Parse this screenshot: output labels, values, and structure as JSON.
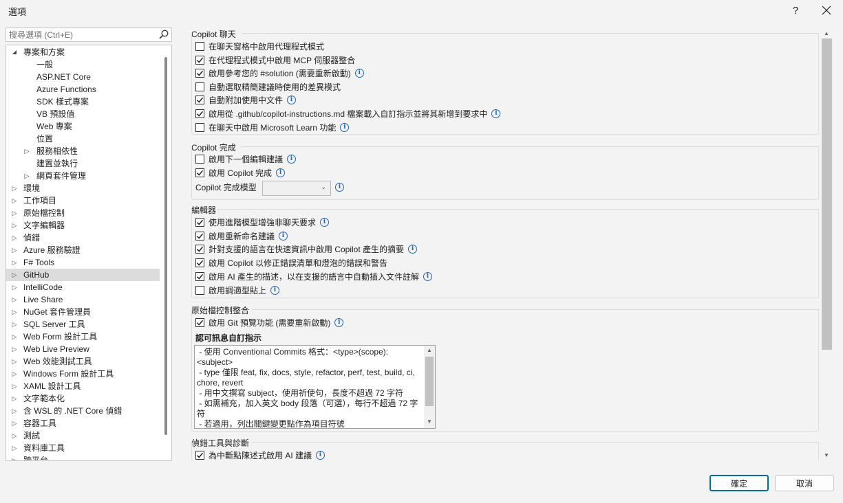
{
  "window": {
    "title": "選項",
    "help_label": "?",
    "close_label": "✕"
  },
  "search": {
    "placeholder": "搜尋選項 (Ctrl+E)"
  },
  "tree": {
    "items": [
      {
        "label": "專案和方案",
        "arrow": "◢",
        "expanded": true
      },
      {
        "label": "一般"
      },
      {
        "label": "ASP.NET Core"
      },
      {
        "label": "Azure Functions"
      },
      {
        "label": "SDK 樣式專案"
      },
      {
        "label": "VB 預設值"
      },
      {
        "label": "Web 專案"
      },
      {
        "label": "位置"
      },
      {
        "label": "服務相依性",
        "arrow": "▷"
      },
      {
        "label": "建置並執行"
      },
      {
        "label": "網頁套件管理",
        "arrow": "▷"
      },
      {
        "label": "環境",
        "arrow": "▷"
      },
      {
        "label": "工作項目",
        "arrow": "▷"
      },
      {
        "label": "原始檔控制",
        "arrow": "▷"
      },
      {
        "label": "文字編輯器",
        "arrow": "▷"
      },
      {
        "label": "偵錯",
        "arrow": "▷"
      },
      {
        "label": "Azure 服務驗證",
        "arrow": "▷"
      },
      {
        "label": "F# Tools",
        "arrow": "▷"
      },
      {
        "label": "GitHub",
        "arrow": "▷",
        "selected": true
      },
      {
        "label": "IntelliCode",
        "arrow": "▷"
      },
      {
        "label": "Live Share",
        "arrow": "▷"
      },
      {
        "label": "NuGet 套件管理員",
        "arrow": "▷"
      },
      {
        "label": "SQL Server 工具",
        "arrow": "▷"
      },
      {
        "label": "Web Form 設計工具",
        "arrow": "▷"
      },
      {
        "label": "Web Live Preview",
        "arrow": "▷"
      },
      {
        "label": "Web 效能測試工具",
        "arrow": "▷"
      },
      {
        "label": "Windows Form 設計工具",
        "arrow": "▷"
      },
      {
        "label": "XAML 設計工具",
        "arrow": "▷"
      },
      {
        "label": "文字範本化",
        "arrow": "▷"
      },
      {
        "label": "含 WSL 的 .NET Core 偵錯",
        "arrow": "▷"
      },
      {
        "label": "容器工具",
        "arrow": "▷"
      },
      {
        "label": "測試",
        "arrow": "▷"
      },
      {
        "label": "資料庫工具",
        "arrow": "▷"
      },
      {
        "label": "跨平台",
        "arrow": "▷"
      }
    ]
  },
  "sections": {
    "chat": {
      "title": "Copilot 聊天",
      "options": [
        {
          "label": "在聊天窗格中啟用代理程式模式",
          "checked": false,
          "info": false
        },
        {
          "label": "在代理程式模式中啟用 MCP 伺服器整合",
          "checked": true,
          "info": false
        },
        {
          "label": "啟用參考您的 #solution (需要重新啟動)",
          "checked": true,
          "info": true
        },
        {
          "label": "自動選取精簡建議時使用的差異模式",
          "checked": false,
          "info": false
        },
        {
          "label": "自動附加使用中文件",
          "checked": true,
          "info": true
        },
        {
          "label": "啟用從 .github/copilot-instructions.md 檔案載入自訂指示並將其新增到要求中",
          "checked": true,
          "info": true
        },
        {
          "label": "在聊天中啟用 Microsoft Learn 功能",
          "checked": false,
          "info": true
        }
      ]
    },
    "completion": {
      "title": "Copilot 完成",
      "options": [
        {
          "label": "啟用下一個編輯建議",
          "checked": false,
          "info": true
        },
        {
          "label": "啟用 Copilot 完成",
          "checked": true,
          "info": true
        }
      ],
      "model_label": "Copilot 完成模型",
      "model_value": ""
    },
    "editor": {
      "title": "編輯器",
      "options": [
        {
          "label": "使用進階模型增強非聊天要求",
          "checked": true,
          "info": true
        },
        {
          "label": "啟用重新命名建議",
          "checked": true,
          "info": true
        },
        {
          "label": "針對支援的語言在快速資訊中啟用 Copilot 產生的摘要",
          "checked": true,
          "info": true
        },
        {
          "label": "啟用 Copilot 以修正錯誤清單和燈泡的錯誤和警告",
          "checked": true,
          "info": false
        },
        {
          "label": "啟用 AI 產生的描述，以在支援的語言中自動插入文件註解",
          "checked": true,
          "info": true
        },
        {
          "label": "啟用調適型貼上",
          "checked": false,
          "info": true
        }
      ]
    },
    "source_control": {
      "title": "原始檔控制整合",
      "options": [
        {
          "label": "啟用 Git 預覽功能 (需要重新啟動)",
          "checked": true,
          "info": true
        }
      ],
      "commit_label": "認可訊息自訂指示",
      "commit_text": " - 使用 Conventional Commits 格式：<type>(scope): <subject>\n - type 僅限 feat, fix, docs, style, refactor, perf, test, build, ci, chore, revert\n - 用中文撰寫 subject，使用祈使句，長度不超過 72 字符\n - 如需補充，加入英文 body 段落（可選），每行不超過 72 字符\n - 若適用，列出關鍵變更點作為項目符號"
    },
    "debug": {
      "title": "偵錯工具與診斷",
      "options": [
        {
          "label": "為中斷點陳述式啟用 AI 建議",
          "checked": true,
          "info": true
        }
      ]
    }
  },
  "footer": {
    "ok_label": "確定",
    "cancel_label": "取消"
  },
  "colors": {
    "accent": "#0067c0",
    "info": "#1a66c0",
    "selected_row": "#dcdcdc"
  }
}
